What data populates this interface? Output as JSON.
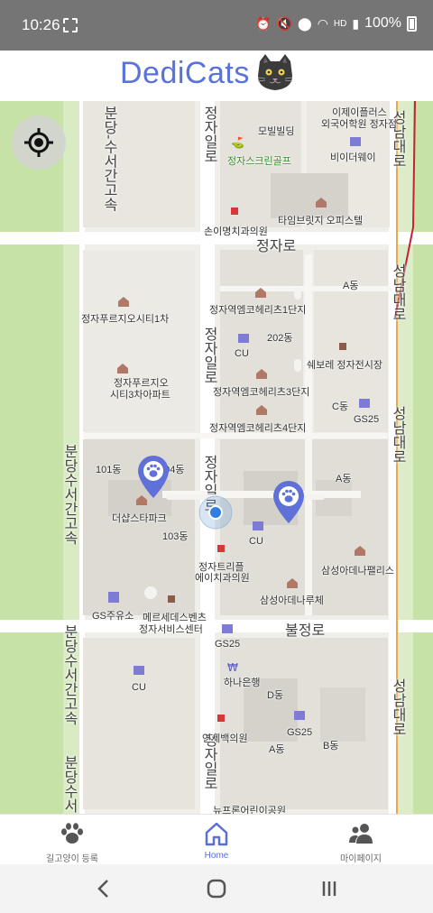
{
  "status_bar": {
    "time": "10:26",
    "battery": "100%",
    "icons": [
      "alarm-icon",
      "mute-icon",
      "location-icon",
      "wifi-icon",
      "hd-icon",
      "signal-icon",
      "battery-icon"
    ]
  },
  "app": {
    "title": "DediCats",
    "logo_icon": "cat-face-icon",
    "accent": "#5a73d9"
  },
  "map": {
    "labels": {
      "l_top1": "이제이플러스",
      "l_top2": "외국어학원 정자점",
      "l_mobil": "모빌빌딩",
      "l_golf": "정자스크린골프",
      "l_baidu": "비이더웨이",
      "l_tower": "타임브릿지 오피스텔",
      "l_clinic": "손이명치과의원",
      "l_a_top": "A동",
      "l_pr1": "정자푸르지오시티1차",
      "l_hills1": "정자역엠코헤리츠1단지",
      "l_202": "202동",
      "l_cu1": "CU",
      "l_market": "쉐보레 정자전시장",
      "l_pr3a": "정자푸르지오",
      "l_pr3b": "시티3차아파트",
      "l_hills3": "정자역엠코헤리츠3단지",
      "l_c": "C동",
      "l_gs1": "GS25",
      "l_hills4": "정자역엠코헤리츠4단지",
      "l_101": "101동",
      "l_104": "104동",
      "l_a_mid": "A동",
      "l_park": "더샵스타파크",
      "l_103": "103동",
      "l_cu2": "CU",
      "l_dental1": "정자트리플",
      "l_dental2": "에이치과의원",
      "l_samsung": "삼성아데나팰리스",
      "l_renu": "삼성아데나루체",
      "l_gsoil": "GS주유소",
      "l_svc1": "메르세데스벤츠",
      "l_svc2": "정자서비스센터",
      "l_gs2": "GS25",
      "l_hana": "하나은행",
      "l_cu3": "CU",
      "l_d": "D동",
      "l_gs3": "GS25",
      "l_yonsei": "연세백의원",
      "l_a_bot": "A동",
      "l_b": "B동",
      "l_bottom": "뉴프론어린이공원"
    },
    "roads": {
      "jeongjaro": "정자로",
      "buljeongro": "불정로",
      "jeongjaillo_top": "정자일로",
      "jeongjaillo_mid": "정자일로",
      "jeongjaillo_lower": "정자일로",
      "jeongjaillo_bottom": "정자일로",
      "seongnamdaero_top": "성남대로",
      "seongnamdaero_a": "성남대로",
      "seongnamdaero_b": "성남대로",
      "seongnamdaero_c": "성남대로",
      "expressway_1": "분당수서간고속",
      "expressway_2": "분당수서간고속",
      "expressway_3": "분당수서간고속",
      "expressway_4": "분당수서",
      "expressway_top": "분당-수서간고속"
    },
    "current_location_icon": "my-location-icon",
    "markers": [
      "cat-paw-marker",
      "cat-paw-marker"
    ],
    "marker_color": "#5f70d8"
  },
  "bottom_nav": [
    {
      "label": "길고양이 등록",
      "icon": "paw-icon",
      "active": false
    },
    {
      "label": "Home",
      "icon": "home-icon",
      "active": true
    },
    {
      "label": "마이페이지",
      "icon": "people-icon",
      "active": false
    }
  ],
  "system_nav": [
    "back-icon",
    "home-circle-icon",
    "recents-icon"
  ]
}
